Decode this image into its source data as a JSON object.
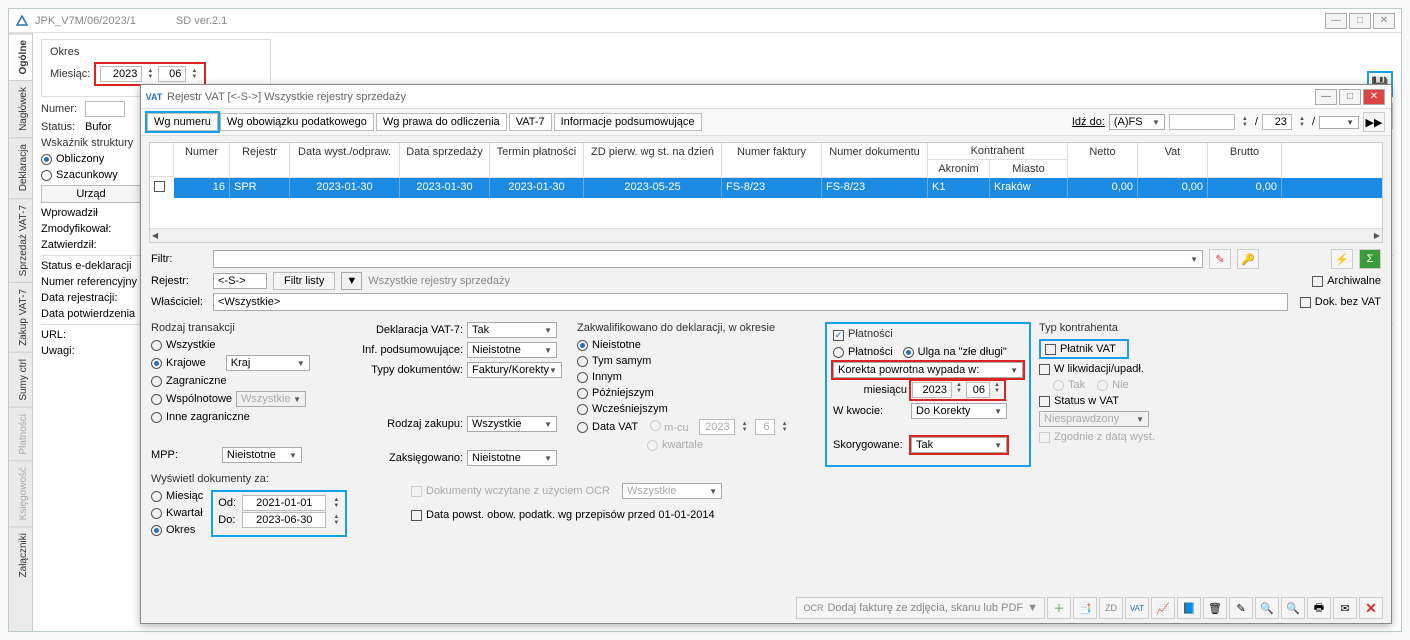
{
  "outer_window": {
    "title": "JPK_V7M/06/2023/1",
    "version": "SD ver.2.1"
  },
  "side_tabs": [
    "Ogólne",
    "Nagłówek",
    "Deklaracja",
    "Sprzedaż VAT-7",
    "Zakup VAT-7",
    "Sumy ctrl",
    "Płatności",
    "Księgowość",
    "Załączniki"
  ],
  "okres": {
    "title": "Okres",
    "month_label": "Miesiąc:",
    "year": "2023",
    "month": "06",
    "numer_label": "Numer:",
    "status_label": "Status:",
    "status_value": "Bufor",
    "wsk_title": "Wskaźnik struktury",
    "oblicz": "Obliczony",
    "szac": "Szacunkowy",
    "urzad": "Urząd",
    "wprowadzil": "Wprowadził",
    "zmodyfikowal": "Zmodyfikował:",
    "zatwierdzil": "Zatwierdził:",
    "status_edecl": "Status e-deklaracji",
    "numer_ref": "Numer referencyjny",
    "data_rej": "Data rejestracji:",
    "data_potw": "Data potwierdzenia",
    "url": "URL:",
    "uwagi": "Uwagi:"
  },
  "inner_window": {
    "title": "Rejestr VAT  [<-S->]   Wszystkie rejestry sprzedaży"
  },
  "subtabs": [
    "Wg numeru",
    "Wg obowiązku podatkowego",
    "Wg prawa do odliczenia",
    "VAT-7",
    "Informacje podsumowujące"
  ],
  "nav": {
    "idz_do": "Idź do:",
    "idz_val": "(A)FS",
    "num": "23",
    "slash": "/"
  },
  "table": {
    "headers": [
      "",
      "Numer",
      "Rejestr",
      "Data wyst./odpraw.",
      "Data sprzedaży",
      "Termin płatności",
      "ZD pierw. wg st. na dzień",
      "Numer faktury",
      "Numer dokumentu",
      "Akronim",
      "Miasto",
      "Netto",
      "Vat",
      "Brutto"
    ],
    "kontrahent_header": "Kontrahent",
    "row": [
      "",
      "16",
      "SPR",
      "2023-01-30",
      "2023-01-30",
      "2023-01-30",
      "2023-05-25",
      "FS-8/23",
      "FS-8/23",
      "K1",
      "Kraków",
      "0,00",
      "0,00",
      "0,00"
    ]
  },
  "filters": {
    "filtr": "Filtr:",
    "rejestr": "Rejestr:",
    "rejestr_val": "<-S->",
    "filtr_listy": "Filtr listy",
    "rejestr_desc": "Wszystkie rejestry sprzedaży",
    "wlasciciel": "Właściciel:",
    "wlasciciel_val": "<Wszystkie>",
    "archiwalne": "Archiwalne",
    "dok_bez_vat": "Dok. bez VAT"
  },
  "rodzaj_trans": {
    "title": "Rodzaj transakcji",
    "wszystkie": "Wszystkie",
    "krajowe": "Krajowe",
    "kraj": "Kraj",
    "zagraniczne": "Zagraniczne",
    "wspolnotowe": "Wspólnotowe",
    "wspolnotowe_val": "Wszystkie",
    "inne_zagr": "Inne zagraniczne",
    "mpp": "MPP:",
    "mpp_val": "Nieistotne"
  },
  "srodek": {
    "dekl_vat7": "Deklaracja VAT-7:",
    "dekl_val": "Tak",
    "inf_pods": "Inf. podsumowujące:",
    "inf_val": "Nieistotne",
    "typy_dok": "Typy dokumentów:",
    "typy_val": "Faktury/Korekty",
    "rodzaj_zak": "Rodzaj zakupu:",
    "rodzaj_zak_val": "Wszystkie",
    "zaksiegowano": "Zaksięgowano:",
    "zaksiegowano_val": "Nieistotne"
  },
  "zakwal": {
    "title": "Zakwalifikowano do deklaracji, w okresie",
    "nieistotne": "Nieistotne",
    "tym_samym": "Tym samym",
    "innym": "Innym",
    "pozniejszym": "Późniejszym",
    "wczesniejszym": "Wcześniejszym",
    "data_vat": "Data VAT",
    "m_cu": "m-cu",
    "kwartale": "kwartale",
    "year": "2023",
    "mon": "6"
  },
  "platnosci": {
    "title": "Płatności",
    "platnosci": "Płatności",
    "ulga": "Ulga na \"złe długi\"",
    "korekta": "Korekta powrotna wypada w:",
    "miesiacu": "miesiącu",
    "year": "2023",
    "mon": "06",
    "w_kwocie": "W kwocie:",
    "w_kwocie_val": "Do Korekty",
    "skorygowane": "Skorygowane:",
    "skoryg_val": "Tak"
  },
  "typ_kontr": {
    "title": "Typ kontrahenta",
    "platnik": "Płatnik VAT",
    "likwidacja": "W likwidacji/upadł.",
    "tak": "Tak",
    "nie": "Nie",
    "status_vat": "Status w VAT",
    "status_val": "Niesprawdzony",
    "zgodnie": "Zgodnie z datą wyst."
  },
  "wyswietl": {
    "title": "Wyświetl dokumenty za:",
    "miesiac": "Miesiąc",
    "kwartal": "Kwartał",
    "okres": "Okres",
    "od": "Od:",
    "od_val": "2021-01-01",
    "do": "Do:",
    "do_val": "2023-06-30"
  },
  "bottom": {
    "ocr": "Dokumenty wczytane z użyciem OCR",
    "ocr_val": "Wszystkie",
    "data_powst": "Data powst. obow. podatk. wg przepisów przed 01-01-2014",
    "dodaj": "Dodaj fakturę ze zdjęcia, skanu lub PDF"
  }
}
